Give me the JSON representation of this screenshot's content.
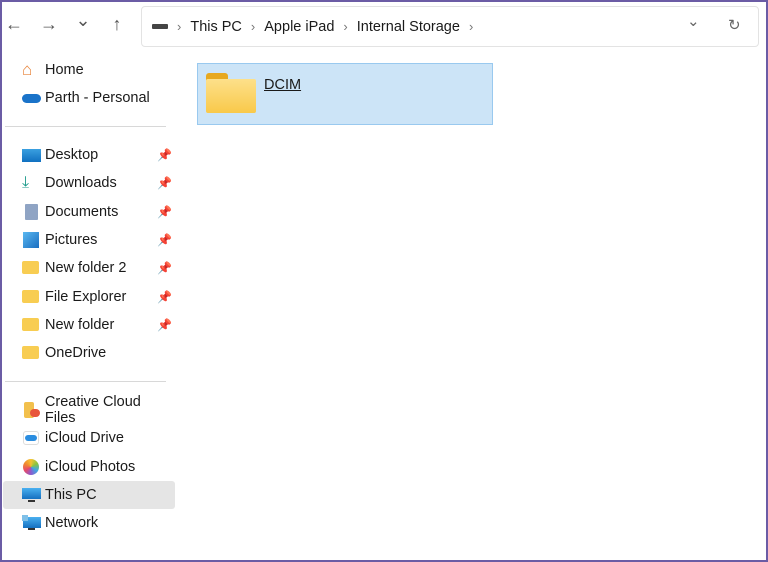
{
  "toolbar": {
    "back": "←",
    "forward": "→",
    "recent": "⌄",
    "up": "↑",
    "dropdown": "⌄",
    "refresh": "↻"
  },
  "breadcrumb": [
    "This PC",
    "Apple iPad",
    "Internal Storage"
  ],
  "sidebar": {
    "top": [
      {
        "label": "Home"
      },
      {
        "label": "Parth - Personal"
      }
    ],
    "quick": [
      {
        "label": "Desktop"
      },
      {
        "label": "Downloads"
      },
      {
        "label": "Documents"
      },
      {
        "label": "Pictures"
      },
      {
        "label": "New folder 2"
      },
      {
        "label": "File Explorer"
      },
      {
        "label": "New folder"
      },
      {
        "label": "OneDrive"
      }
    ],
    "places": [
      {
        "label": "Creative Cloud Files"
      },
      {
        "label": "iCloud Drive"
      },
      {
        "label": "iCloud Photos"
      },
      {
        "label": "This PC"
      },
      {
        "label": "Network"
      }
    ]
  },
  "content": {
    "items": [
      {
        "name": "DCIM"
      }
    ]
  }
}
